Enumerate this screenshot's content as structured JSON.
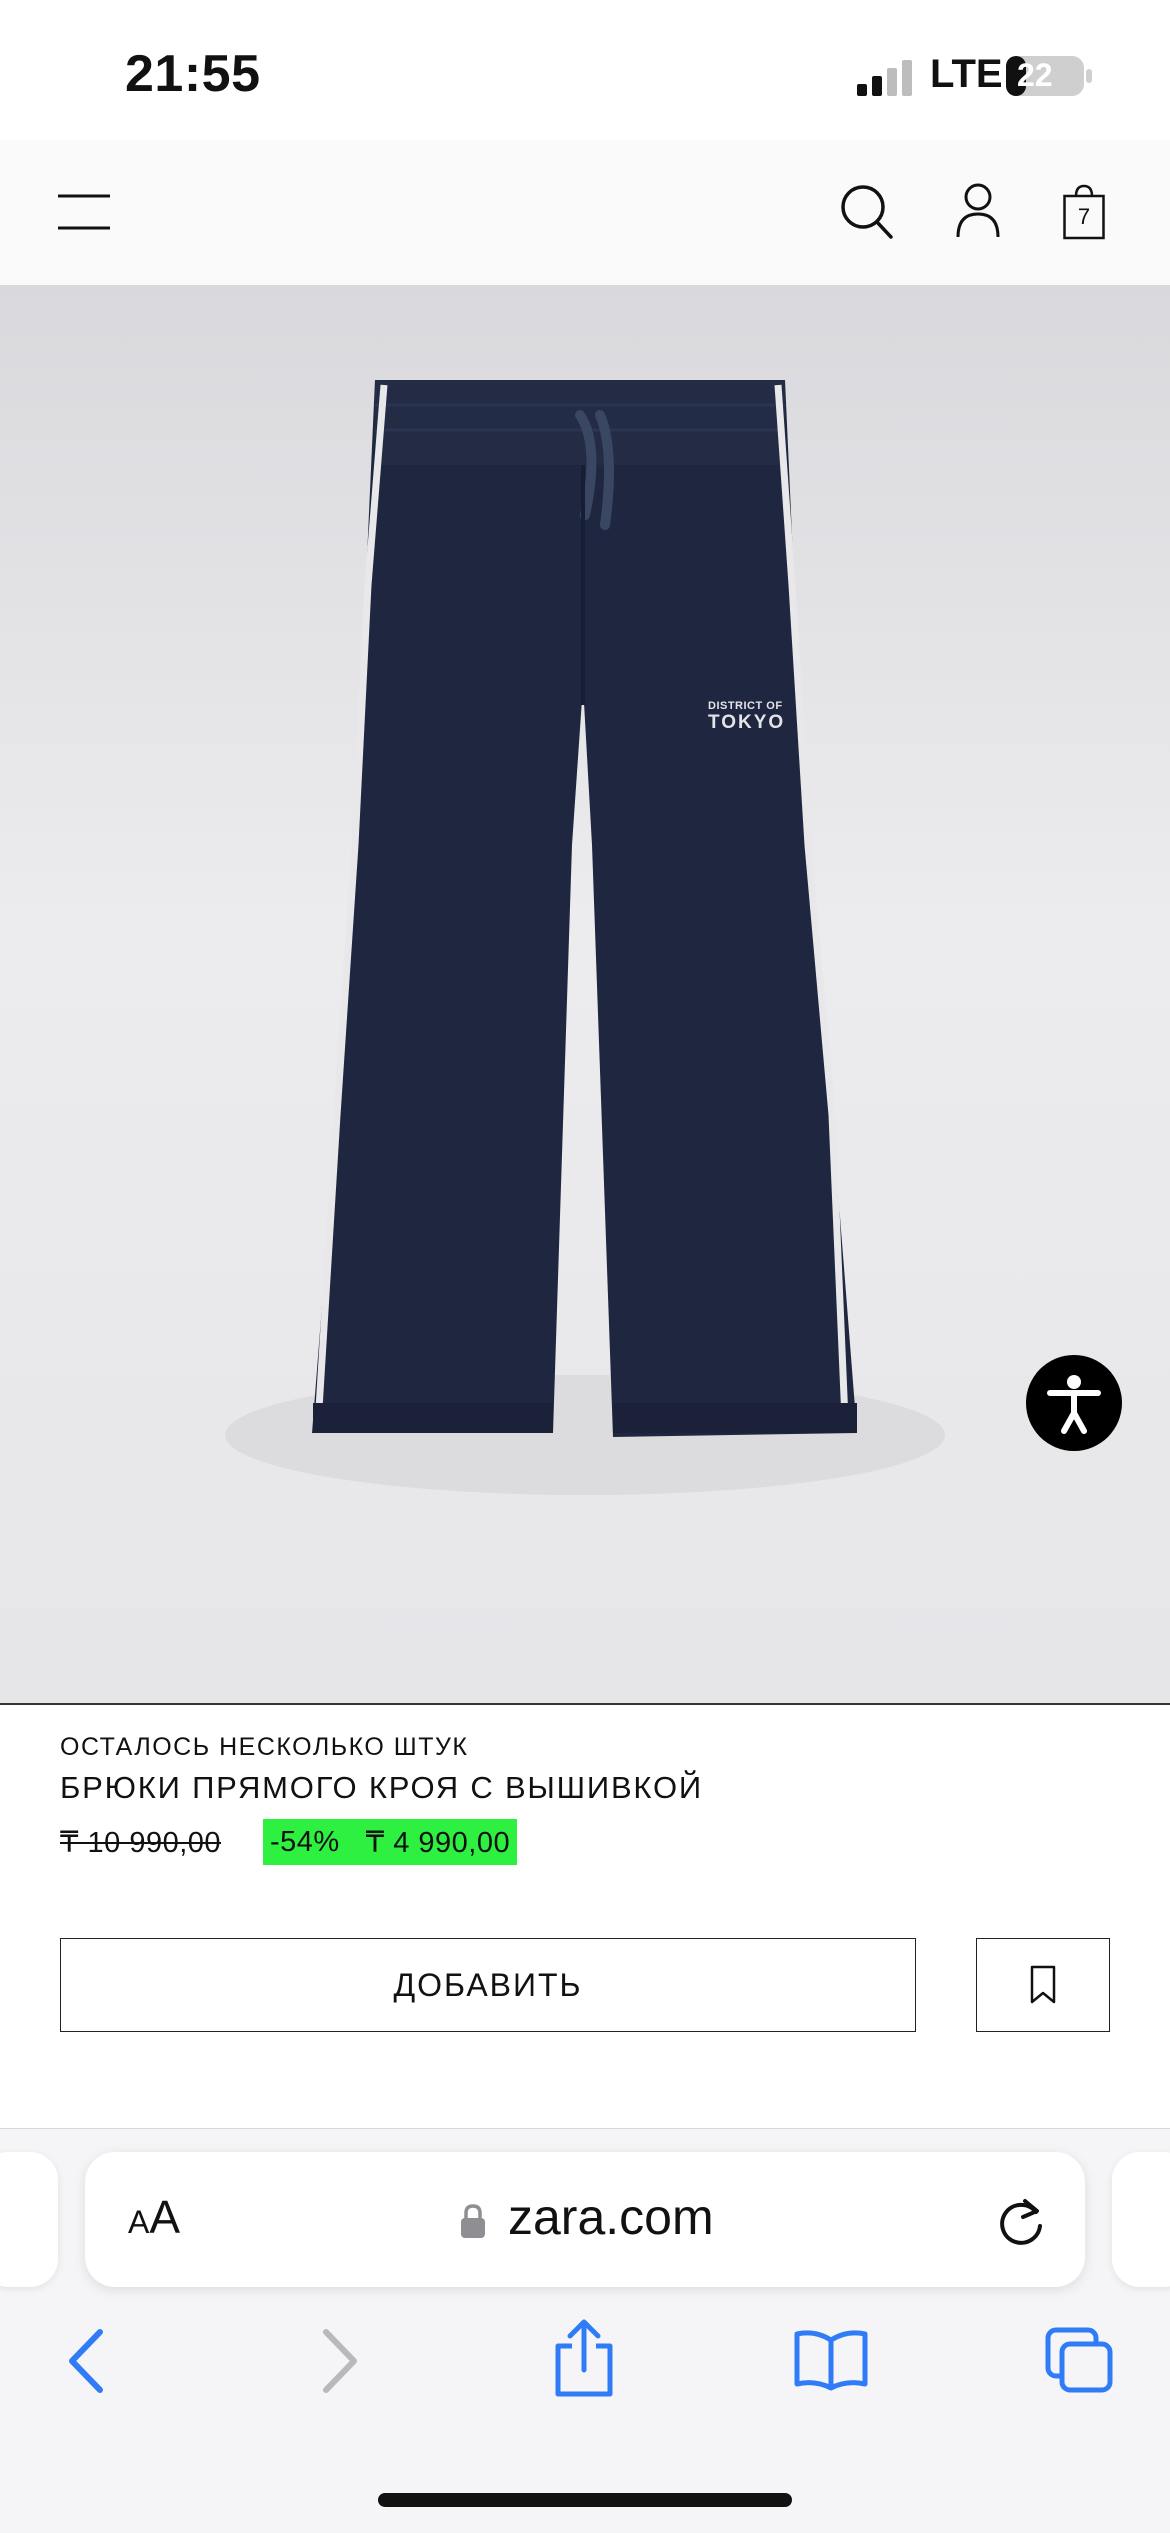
{
  "status_bar": {
    "time": "21:55",
    "network": "LTE",
    "battery": "22"
  },
  "header": {
    "cart_count": "7",
    "icons": [
      "menu-icon",
      "search-icon",
      "account-icon",
      "shopping-bag-icon"
    ]
  },
  "product_image": {
    "print_line1": "DISTRICT OF",
    "print_line2": "TOKYO"
  },
  "product": {
    "stock_label": "ОСТАЛОСЬ НЕСКОЛЬКО ШТУК",
    "name": "БРЮКИ ПРЯМОГО КРОЯ С ВЫШИВКОЙ",
    "old_price": "₸ 10 990,00",
    "discount": "-54%",
    "new_price": "₸ 4 990,00",
    "add_button_label": "ДОБАВИТЬ"
  },
  "browser": {
    "text_size_small": "A",
    "text_size_large": "A",
    "url": "zara.com",
    "nav_icons": [
      "back-icon",
      "forward-icon",
      "share-icon",
      "bookmarks-icon",
      "tabs-icon"
    ]
  },
  "colors": {
    "discount_highlight": "#2ef040",
    "pants": "#1f2740",
    "ios_blue": "#2f7cf6",
    "disabled_gray": "#b9b9bd"
  }
}
